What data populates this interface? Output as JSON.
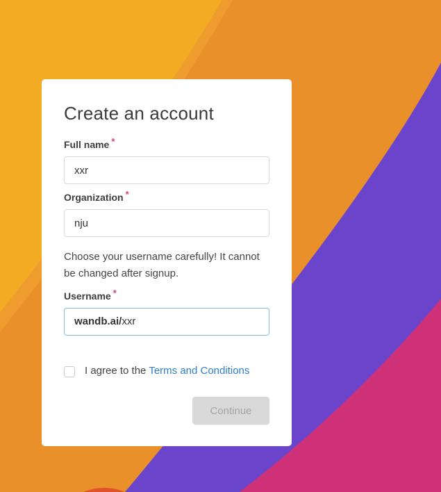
{
  "form": {
    "title": "Create an account",
    "required_mark": "*",
    "full_name": {
      "label": "Full name",
      "value": "xxr"
    },
    "organization": {
      "label": "Organization",
      "value": "nju"
    },
    "username_help": "Choose your username carefully! It cannot be changed after signup.",
    "username": {
      "label": "Username",
      "prefix": "wandb.ai/",
      "value": "xxr"
    },
    "agree_text": "I agree to the",
    "terms_link": "Terms and Conditions",
    "agree_checked": false,
    "continue_label": "Continue"
  },
  "colors": {
    "bg_orange": "#ea8f2a",
    "bg_yellow": "#f2ab22",
    "bg_purple": "#6a45cc",
    "bg_pink": "#cf3178",
    "link_blue": "#2f7fc6",
    "required_red": "#d9416a"
  }
}
